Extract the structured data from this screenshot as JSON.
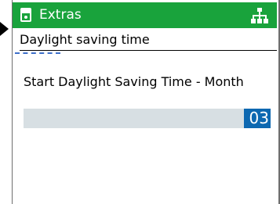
{
  "header": {
    "title": "Extras",
    "device_icon": "device-icon",
    "network_icon": "network-tree-icon",
    "accent_color": "#19a33c"
  },
  "tab": {
    "label": "Daylight saving time"
  },
  "parameter": {
    "label": "Start Daylight Saving Time - Month",
    "value": "03",
    "field_color": "#d7dfe3",
    "selection_color": "#0d68b1"
  }
}
